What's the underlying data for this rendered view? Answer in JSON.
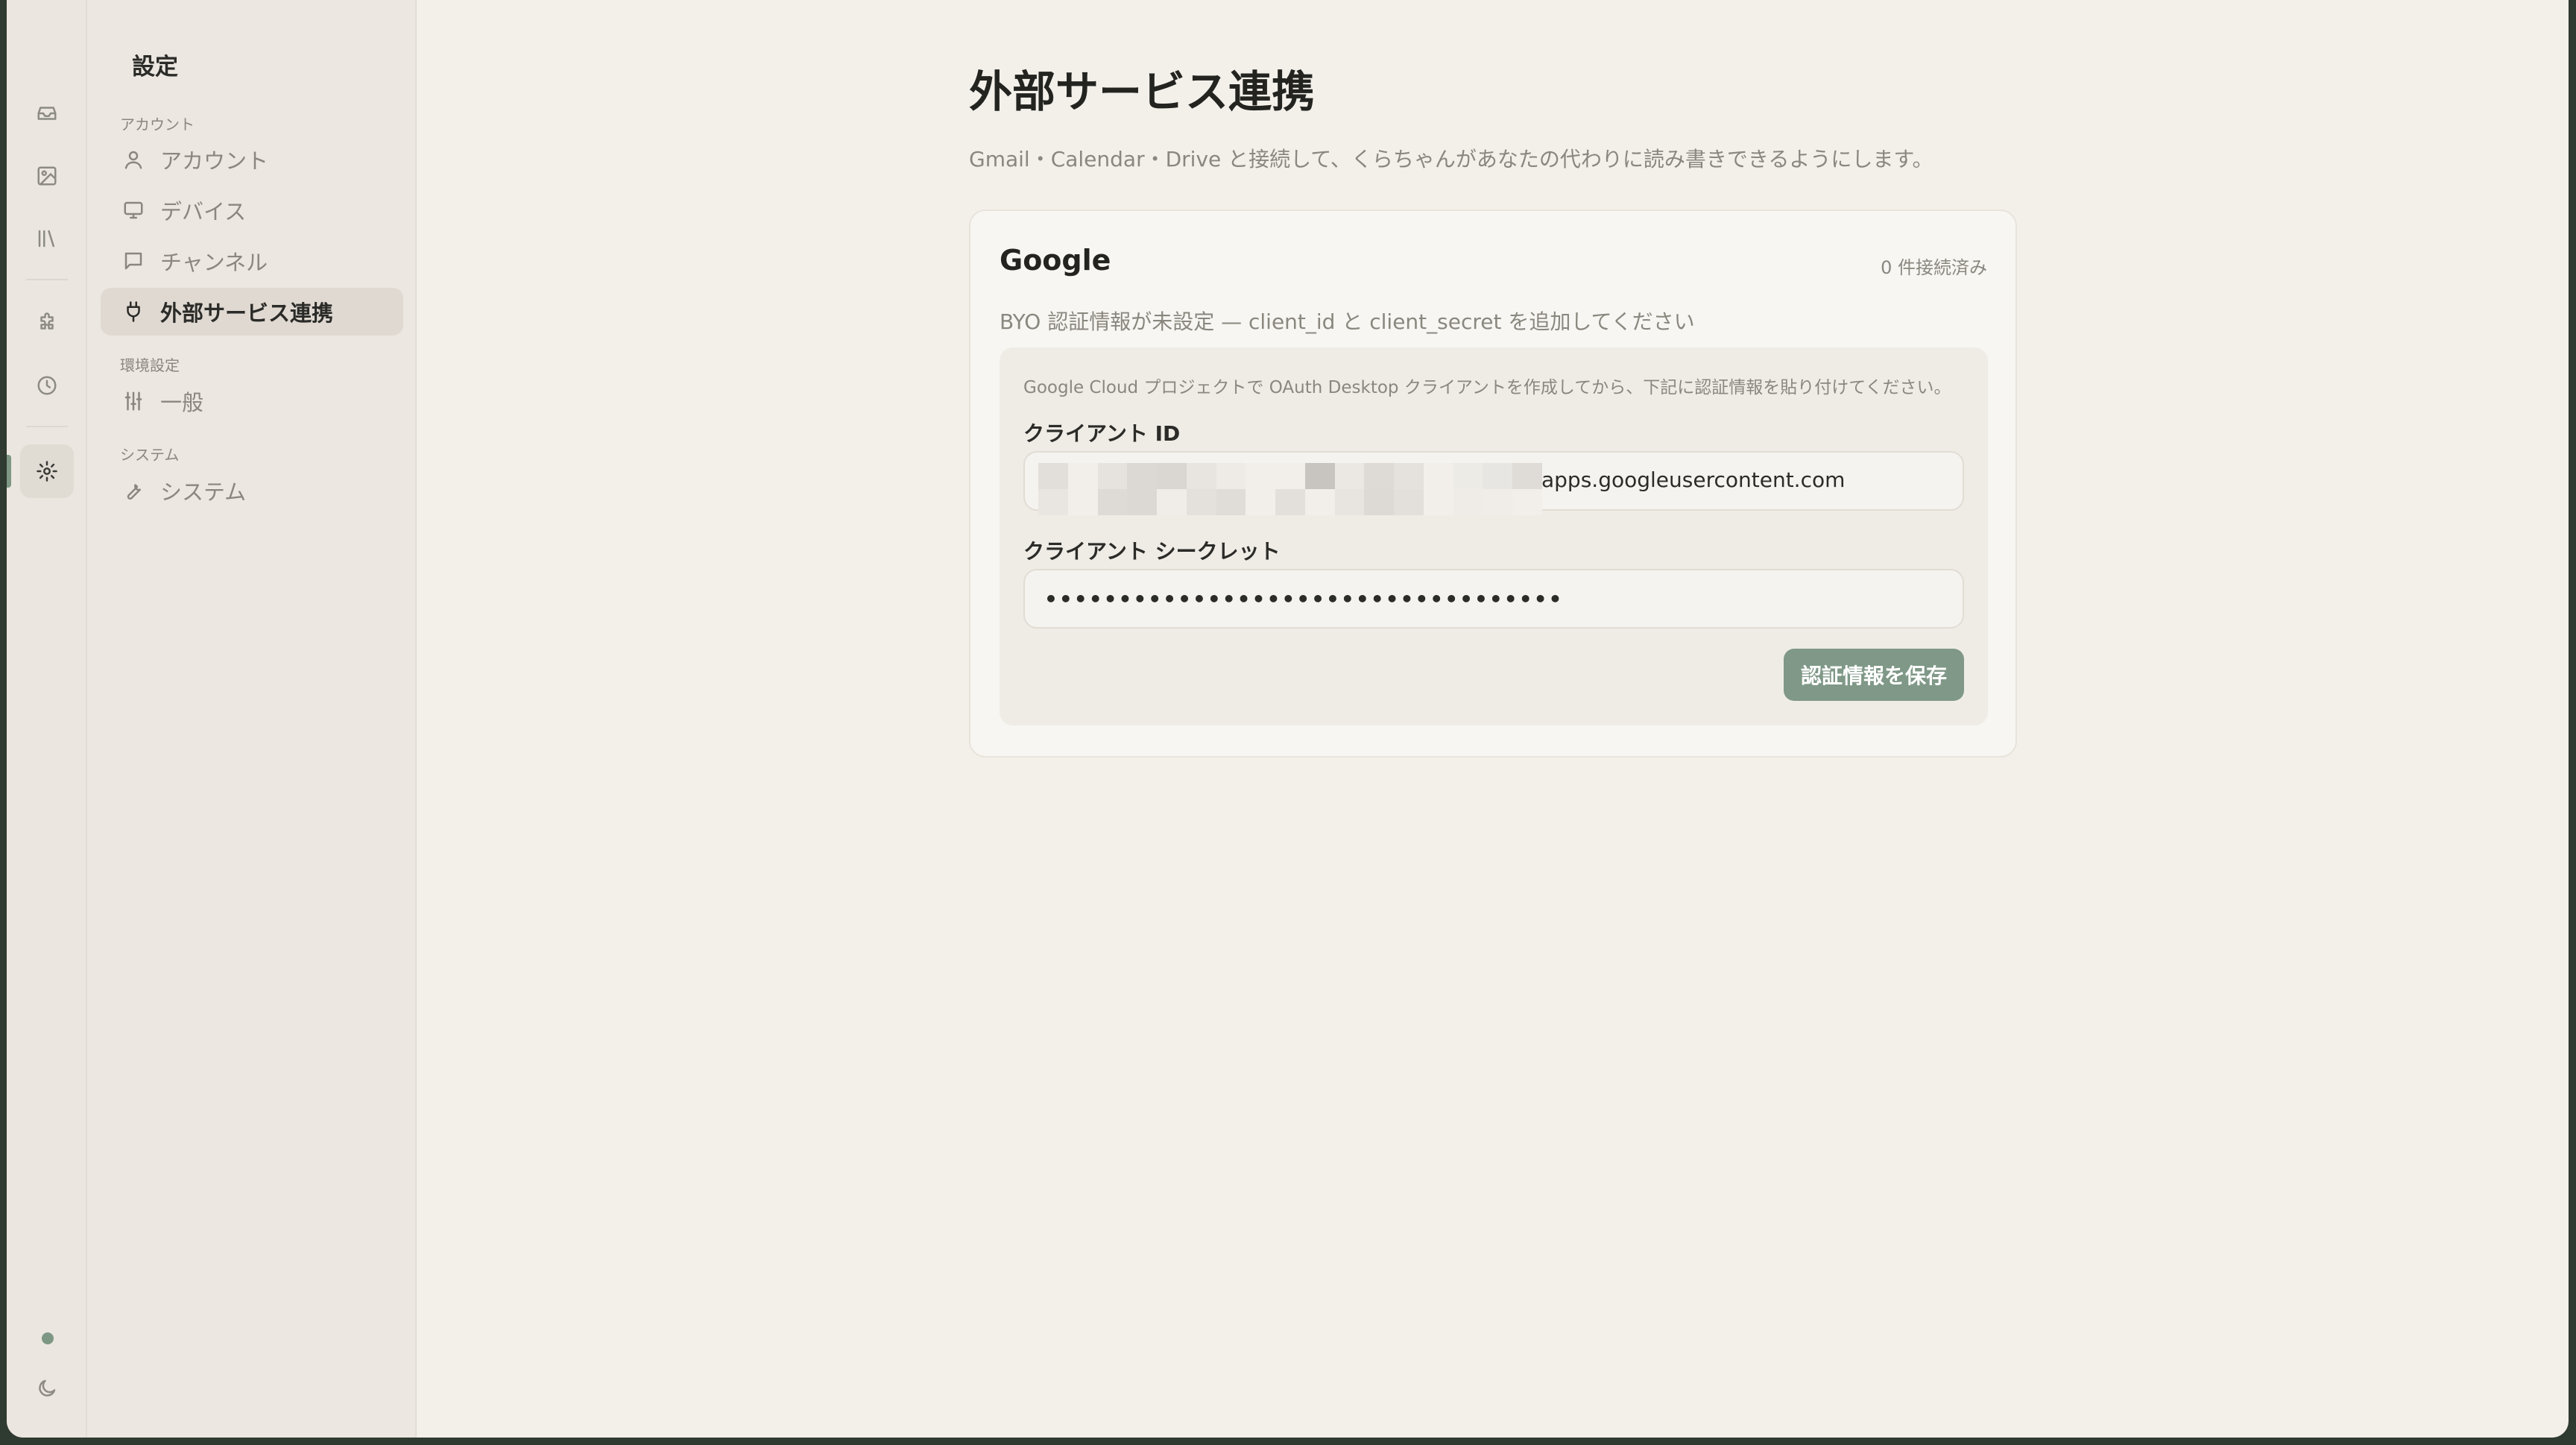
{
  "rail": {
    "icons": [
      "inbox-icon",
      "image-icon",
      "library-icon",
      "puzzle-icon",
      "clock-icon",
      "settings-icon",
      "status-dot",
      "moon-icon"
    ],
    "active": "settings-icon",
    "accent_color": "#7d9784"
  },
  "sidebar": {
    "title": "設定",
    "sections": [
      {
        "label": "アカウント",
        "items": [
          {
            "label": "アカウント",
            "icon": "user-icon"
          },
          {
            "label": "デバイス",
            "icon": "monitor-icon"
          },
          {
            "label": "チャンネル",
            "icon": "message-icon"
          },
          {
            "label": "外部サービス連携",
            "icon": "plug-icon",
            "active": true
          }
        ]
      },
      {
        "label": "環境設定",
        "items": [
          {
            "label": "一般",
            "icon": "sliders-icon"
          }
        ]
      },
      {
        "label": "システム",
        "items": [
          {
            "label": "システム",
            "icon": "wrench-icon"
          }
        ]
      }
    ]
  },
  "main": {
    "title": "外部サービス連携",
    "description": "Gmail・Calendar・Drive と接続して、くらちゃんがあなたの代わりに読み書きできるようにします。",
    "google_card": {
      "title": "Google",
      "count": "0 件接続済み",
      "status": "BYO 認証情報が未設定 — client_id と client_secret を追加してください",
      "help": "Google Cloud プロジェクトで OAuth Desktop クライアントを作成してから、下記に認証情報を貼り付けてください。",
      "client_id_label": "クライアント ID",
      "client_id_suffix": "apps.googleusercontent.com",
      "client_secret_label": "クライアント シークレット",
      "client_secret_value": "•••••••••••••••••••••••••••••••••••",
      "save_label": "認証情報を保存",
      "button_color": "#7f9887"
    }
  }
}
